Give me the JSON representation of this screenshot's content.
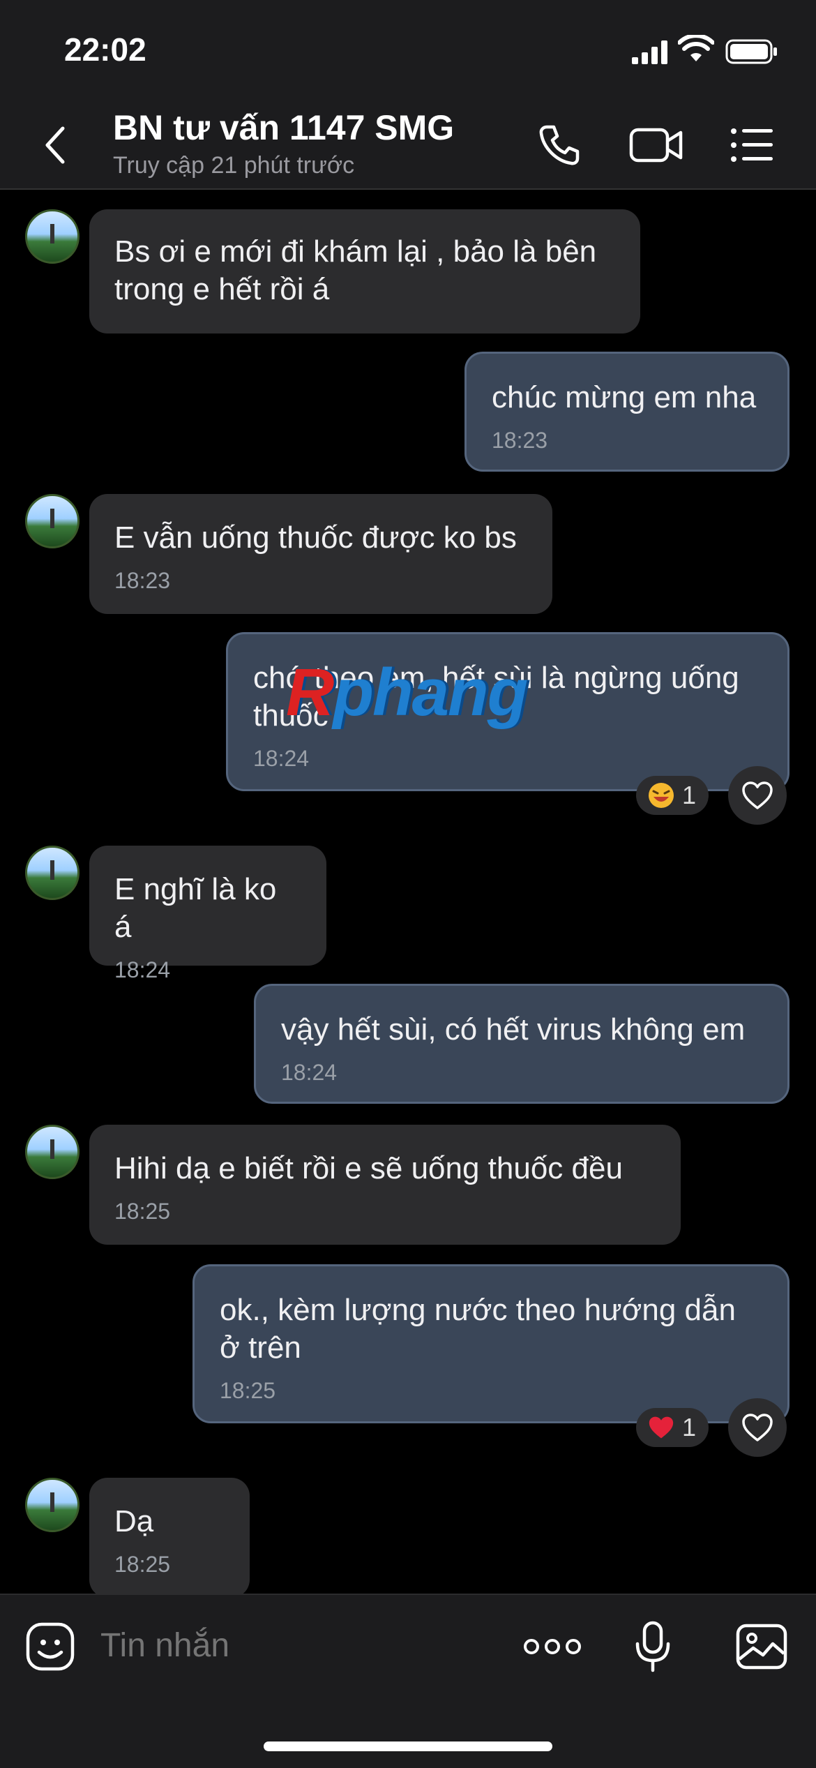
{
  "status": {
    "time": "22:02"
  },
  "header": {
    "title": "BN tư vấn 1147 SMG",
    "subtitle": "Truy cập 21 phút trước"
  },
  "messages": [
    {
      "dir": "in",
      "text": "Bs ơi e mới đi khám lại , bảo là bên trong e hết rồi á",
      "time": ""
    },
    {
      "dir": "out",
      "text": "chúc mừng em nha",
      "time": "18:23"
    },
    {
      "dir": "in",
      "text": "E vẫn uống thuốc được ko bs",
      "time": "18:23"
    },
    {
      "dir": "out",
      "text": "chớ theo em, hết sùi là ngừng uống thuốc",
      "time": "18:24",
      "reaction": {
        "emoji": "laughing",
        "count": "1"
      }
    },
    {
      "dir": "in",
      "text": "E nghĩ là ko á",
      "time": "18:24"
    },
    {
      "dir": "out",
      "text": "vậy hết sùi, có hết virus không em",
      "time": "18:24"
    },
    {
      "dir": "in",
      "text": "Hihi dạ e biết rồi e  sẽ uống thuốc đều",
      "time": "18:25"
    },
    {
      "dir": "out",
      "text": "ok., kèm lượng nước theo hướng dẫn ở trên",
      "time": "18:25",
      "reaction": {
        "emoji": "heart",
        "count": "1"
      }
    },
    {
      "dir": "in",
      "text": "Dạ",
      "time": "18:25"
    }
  ],
  "watermark": {
    "first": "R",
    "rest": "phang"
  },
  "composer": {
    "placeholder": "Tin nhắn"
  },
  "colors": {
    "bubble_in": "#2c2c2e",
    "bubble_out": "#3a4658",
    "background": "#000000"
  }
}
